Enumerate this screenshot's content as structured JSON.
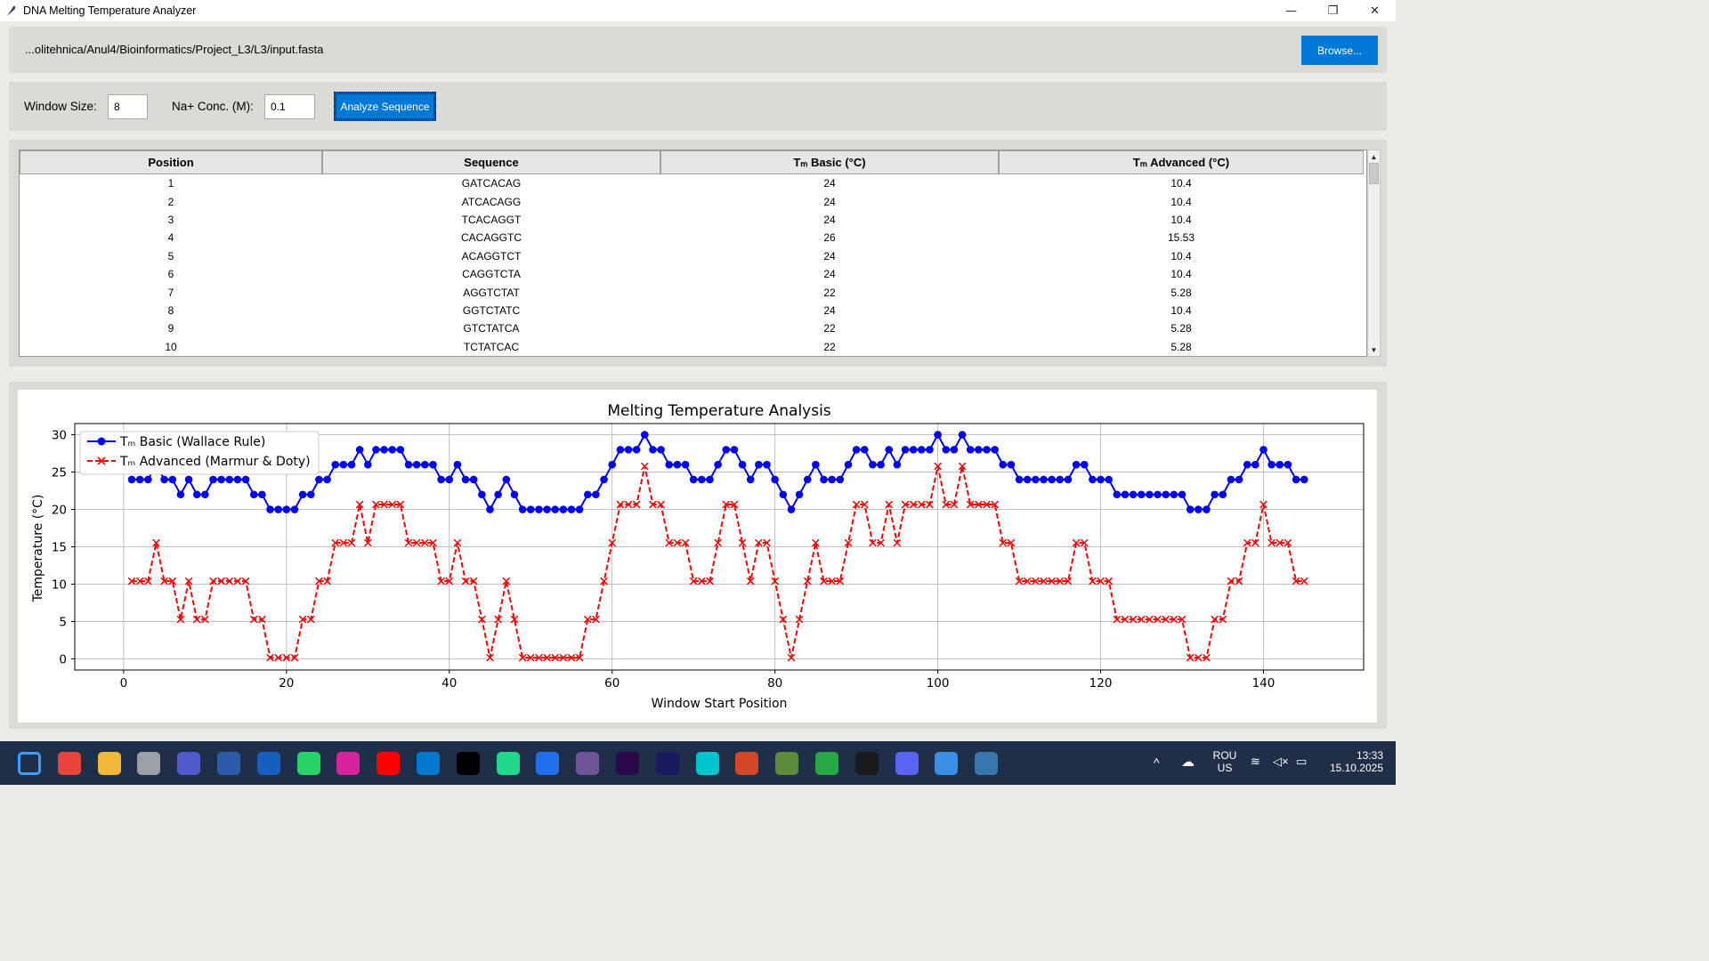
{
  "window": {
    "title": "DNA Melting Temperature Analyzer",
    "controls": [
      "—",
      "❐",
      "✕"
    ]
  },
  "file": {
    "path": "...olitehnica/Anul4/Bioinformatics/Project_L3/L3/input.fasta",
    "browse_label": "Browse..."
  },
  "params": {
    "window_label": "Window Size:",
    "window_value": "8",
    "na_label": "Na+ Conc. (M):",
    "na_value": "0.1",
    "analyze_label": "Analyze Sequence"
  },
  "table": {
    "headers": [
      "Position",
      "Sequence",
      "Tₘ Basic (°C)",
      "Tₘ Advanced (°C)"
    ],
    "rows": [
      [
        "1",
        "GATCACAG",
        "24",
        "10.4"
      ],
      [
        "2",
        "ATCACAGG",
        "24",
        "10.4"
      ],
      [
        "3",
        "TCACAGGT",
        "24",
        "10.4"
      ],
      [
        "4",
        "CACAGGTC",
        "26",
        "15.53"
      ],
      [
        "5",
        "ACAGGTCT",
        "24",
        "10.4"
      ],
      [
        "6",
        "CAGGTCTA",
        "24",
        "10.4"
      ],
      [
        "7",
        "AGGTCTAT",
        "22",
        "5.28"
      ],
      [
        "8",
        "GGTCTATC",
        "24",
        "10.4"
      ],
      [
        "9",
        "GTCTATCA",
        "22",
        "5.28"
      ],
      [
        "10",
        "TCTATCAC",
        "22",
        "5.28"
      ]
    ]
  },
  "chart_data": {
    "type": "line",
    "title": "Melting Temperature Analysis",
    "xlabel": "Window Start Position",
    "ylabel": "Temperature (°C)",
    "xlim": [
      -6,
      152.3
    ],
    "ylim": [
      -1.5,
      31.5
    ],
    "xticks": [
      0,
      20,
      40,
      60,
      80,
      100,
      120,
      140
    ],
    "yticks": [
      0,
      5,
      10,
      15,
      20,
      25,
      30
    ],
    "grid": true,
    "legend": "top-left",
    "series": [
      {
        "name": "Tₘ Basic (Wallace Rule)",
        "color": "#0000ff",
        "marker": "circle",
        "values": [
          24,
          24,
          24,
          26,
          24,
          24,
          22,
          24,
          22,
          22,
          24,
          24,
          24,
          24,
          24,
          22,
          22,
          20,
          20,
          20,
          20,
          22,
          22,
          24,
          24,
          26,
          26,
          26,
          28,
          26,
          28,
          28,
          28,
          28,
          26,
          26,
          26,
          26,
          24,
          24,
          26,
          24,
          24,
          22,
          20,
          22,
          24,
          22,
          20,
          20,
          20,
          20,
          20,
          20,
          20,
          20,
          22,
          22,
          24,
          26,
          28,
          28,
          28,
          30,
          28,
          28,
          26,
          26,
          26,
          24,
          24,
          24,
          26,
          28,
          28,
          26,
          24,
          26,
          26,
          24,
          22,
          20,
          22,
          24,
          26,
          24,
          24,
          24,
          26,
          28,
          28,
          26,
          26,
          28,
          26,
          28,
          28,
          28,
          28,
          30,
          28,
          28,
          30,
          28,
          28,
          28,
          28,
          26,
          26,
          24,
          24,
          24,
          24,
          24,
          24,
          24,
          26,
          26,
          24,
          24,
          24,
          22,
          22,
          22,
          22,
          22,
          22,
          22,
          22,
          22,
          20,
          20,
          20,
          22,
          22,
          24,
          24,
          26,
          26,
          28,
          26,
          26,
          26,
          24,
          24
        ]
      },
      {
        "name": "Tₘ Advanced (Marmur & Doty)",
        "color": "#ff0000",
        "marker": "x",
        "values": [
          10.4,
          10.4,
          10.4,
          15.53,
          10.4,
          10.4,
          5.28,
          10.4,
          5.28,
          5.28,
          10.4,
          10.4,
          10.4,
          10.4,
          10.4,
          5.28,
          5.28,
          0.15,
          0.15,
          0.15,
          0.15,
          5.28,
          5.28,
          10.4,
          10.4,
          15.53,
          15.53,
          15.53,
          20.66,
          15.53,
          20.66,
          20.66,
          20.66,
          20.66,
          15.53,
          15.53,
          15.53,
          15.53,
          10.4,
          10.4,
          15.53,
          10.4,
          10.4,
          5.28,
          0.15,
          5.28,
          10.4,
          5.28,
          0.15,
          0.15,
          0.15,
          0.15,
          0.15,
          0.15,
          0.15,
          0.15,
          5.28,
          5.28,
          10.4,
          15.53,
          20.66,
          20.66,
          20.66,
          25.79,
          20.66,
          20.66,
          15.53,
          15.53,
          15.53,
          10.4,
          10.4,
          10.4,
          15.53,
          20.66,
          20.66,
          15.53,
          10.4,
          15.53,
          15.53,
          10.4,
          5.28,
          0.15,
          5.28,
          10.4,
          15.53,
          10.4,
          10.4,
          10.4,
          15.53,
          20.66,
          20.66,
          15.53,
          15.53,
          20.66,
          15.53,
          20.66,
          20.66,
          20.66,
          20.66,
          25.79,
          20.66,
          20.66,
          25.79,
          20.66,
          20.66,
          20.66,
          20.66,
          15.53,
          15.53,
          10.4,
          10.4,
          10.4,
          10.4,
          10.4,
          10.4,
          10.4,
          15.53,
          15.53,
          10.4,
          10.4,
          10.4,
          5.28,
          5.28,
          5.28,
          5.28,
          5.28,
          5.28,
          5.28,
          5.28,
          5.28,
          0.15,
          0.15,
          0.15,
          5.28,
          5.28,
          10.4,
          10.4,
          15.53,
          15.53,
          20.66,
          15.53,
          15.53,
          15.53,
          10.4,
          10.4
        ]
      }
    ]
  },
  "taskbar": {
    "apps": [
      "windows-start",
      "chrome",
      "file-explorer",
      "apple",
      "teams",
      "powershell",
      "defender",
      "whatsapp",
      "instagram",
      "youtube",
      "vscode",
      "intellij",
      "pycharm",
      "sourcetree",
      "github",
      "premiere",
      "after-effects",
      "canva",
      "powerpoint",
      "minecraft",
      "xbox",
      "logitech",
      "discord",
      "icloud",
      "python"
    ],
    "lang1": "ROU",
    "lang2": "US",
    "time": "13:33",
    "date": "15.10.2025"
  }
}
